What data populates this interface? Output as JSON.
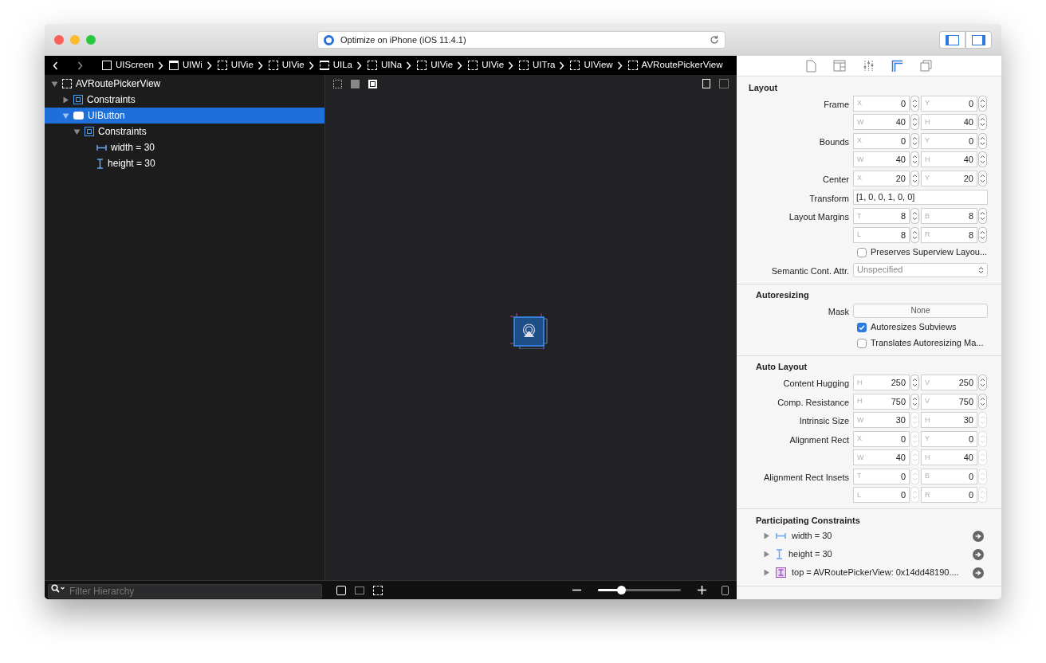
{
  "window": {
    "title": "Optimize on iPhone (iOS 11.4.1)"
  },
  "breadcrumbs": [
    {
      "label": "UIScreen",
      "kind": "screen"
    },
    {
      "label": "UIWi",
      "kind": "window"
    },
    {
      "label": "UIVie",
      "kind": "view"
    },
    {
      "label": "UIVie",
      "kind": "view"
    },
    {
      "label": "UILa",
      "kind": "guide"
    },
    {
      "label": "UINa",
      "kind": "view"
    },
    {
      "label": "UIVie",
      "kind": "view"
    },
    {
      "label": "UIVie",
      "kind": "view"
    },
    {
      "label": "UITra",
      "kind": "view"
    },
    {
      "label": "UIView",
      "kind": "view"
    },
    {
      "label": "AVRoutePickerView",
      "kind": "view"
    }
  ],
  "tree": [
    {
      "label": "AVRoutePickerView",
      "kind": "view",
      "expanded": true,
      "selected": false,
      "children": [
        {
          "label": "Constraints",
          "kind": "constraints",
          "expanded": false,
          "selected": false
        },
        {
          "label": "UIButton",
          "kind": "button",
          "expanded": true,
          "selected": true,
          "children": [
            {
              "label": "Constraints",
              "kind": "constraints",
              "expanded": true,
              "selected": false,
              "children": [
                {
                  "label": "width = 30",
                  "kind": "width"
                },
                {
                  "label": "height = 30",
                  "kind": "height"
                }
              ]
            }
          ]
        }
      ]
    }
  ],
  "filter": {
    "placeholder": "Filter Hierarchy"
  },
  "zoom": {
    "level": 0.28
  },
  "inspector_tabs": [
    {
      "kind": "file",
      "selected": false
    },
    {
      "kind": "layout",
      "selected": false
    },
    {
      "kind": "sliders",
      "selected": false
    },
    {
      "kind": "ruler",
      "selected": true
    },
    {
      "kind": "layers",
      "selected": false
    }
  ],
  "sections": [
    {
      "title": "Layout",
      "rows": [
        {
          "kind": "pair",
          "label": "Frame",
          "fields": [
            {
              "prefix": "X",
              "value": "0"
            },
            {
              "prefix": "Y",
              "value": "0"
            }
          ],
          "disabled": false
        },
        {
          "kind": "pair",
          "label": "",
          "fields": [
            {
              "prefix": "W",
              "value": "40"
            },
            {
              "prefix": "H",
              "value": "40"
            }
          ],
          "disabled": false
        },
        {
          "kind": "pair",
          "label": "Bounds",
          "fields": [
            {
              "prefix": "X",
              "value": "0"
            },
            {
              "prefix": "Y",
              "value": "0"
            }
          ],
          "disabled": false
        },
        {
          "kind": "pair",
          "label": "",
          "fields": [
            {
              "prefix": "W",
              "value": "40"
            },
            {
              "prefix": "H",
              "value": "40"
            }
          ],
          "disabled": false
        },
        {
          "kind": "pair",
          "label": "Center",
          "fields": [
            {
              "prefix": "X",
              "value": "20"
            },
            {
              "prefix": "Y",
              "value": "20"
            }
          ],
          "disabled": false
        },
        {
          "kind": "text",
          "label": "Transform",
          "value": "[1, 0, 0, 1, 0, 0]"
        },
        {
          "kind": "pair",
          "label": "Layout Margins",
          "fields": [
            {
              "prefix": "T",
              "value": "8"
            },
            {
              "prefix": "B",
              "value": "8"
            }
          ],
          "disabled": false
        },
        {
          "kind": "pair",
          "label": "",
          "fields": [
            {
              "prefix": "L",
              "value": "8"
            },
            {
              "prefix": "R",
              "value": "8"
            }
          ],
          "disabled": false
        },
        {
          "kind": "checkbox",
          "label": "Preserves Superview Layou...",
          "checked": false
        },
        {
          "kind": "select",
          "label": "Semantic Cont. Attr.",
          "value": "Unspecified"
        }
      ]
    },
    {
      "title": "Autoresizing",
      "rows": [
        {
          "kind": "button",
          "label": "Mask",
          "value": "None"
        },
        {
          "kind": "checkbox",
          "label": "Autoresizes Subviews",
          "checked": true
        },
        {
          "kind": "checkbox",
          "label": "Translates Autoresizing Ma...",
          "checked": false
        }
      ]
    },
    {
      "title": "Auto Layout",
      "rows": [
        {
          "kind": "pair",
          "label": "Content Hugging",
          "fields": [
            {
              "prefix": "H",
              "value": "250"
            },
            {
              "prefix": "V",
              "value": "250"
            }
          ],
          "disabled": false
        },
        {
          "kind": "pair",
          "label": "Comp. Resistance",
          "fields": [
            {
              "prefix": "H",
              "value": "750"
            },
            {
              "prefix": "V",
              "value": "750"
            }
          ],
          "disabled": false
        },
        {
          "kind": "pair",
          "label": "Intrinsic Size",
          "fields": [
            {
              "prefix": "W",
              "value": "30"
            },
            {
              "prefix": "H",
              "value": "30"
            }
          ],
          "disabled": true
        },
        {
          "kind": "pair",
          "label": "Alignment Rect",
          "fields": [
            {
              "prefix": "X",
              "value": "0"
            },
            {
              "prefix": "Y",
              "value": "0"
            }
          ],
          "disabled": true
        },
        {
          "kind": "pair",
          "label": "",
          "fields": [
            {
              "prefix": "W",
              "value": "40"
            },
            {
              "prefix": "H",
              "value": "40"
            }
          ],
          "disabled": true
        },
        {
          "kind": "pair",
          "label": "Alignment Rect Insets",
          "fields": [
            {
              "prefix": "T",
              "value": "0"
            },
            {
              "prefix": "B",
              "value": "0"
            }
          ],
          "disabled": true
        },
        {
          "kind": "pair",
          "label": "",
          "fields": [
            {
              "prefix": "L",
              "value": "0"
            },
            {
              "prefix": "R",
              "value": "0"
            }
          ],
          "disabled": true
        }
      ]
    },
    {
      "title": "Participating Constraints",
      "rows": [
        {
          "kind": "width_constraint",
          "label": "width = 30",
          "expanded": false
        },
        {
          "kind": "height_constraint",
          "label": "height = 30",
          "expanded": false
        },
        {
          "kind": "top_constraint",
          "label": "top = AVRoutePickerView: 0x14dd48190....",
          "expanded": false
        }
      ]
    }
  ]
}
